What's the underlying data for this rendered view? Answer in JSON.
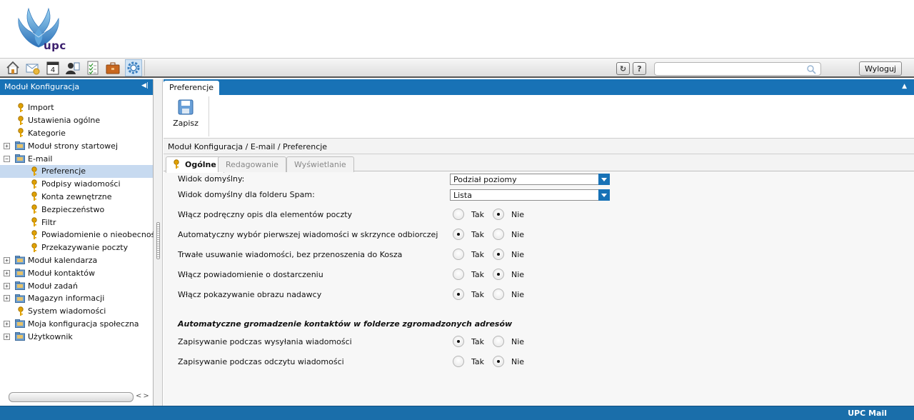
{
  "brand": {
    "logo_text": "upc"
  },
  "toolbar": {
    "icons": [
      "home-icon",
      "mail-icon",
      "calendar-icon",
      "contacts-icon",
      "tasks-icon",
      "briefcase-icon",
      "settings-icon"
    ],
    "calendar_day": "4",
    "refresh_label": "↻",
    "help_label": "?",
    "search_value": "",
    "logout_label": "Wyloguj"
  },
  "left_panel": {
    "title": "Moduł Konfiguracja",
    "items": [
      {
        "label": "Import",
        "type": "key",
        "level": 0,
        "expander": ""
      },
      {
        "label": "Ustawienia ogólne",
        "type": "key",
        "level": 0,
        "expander": ""
      },
      {
        "label": "Kategorie",
        "type": "key",
        "level": 0,
        "expander": ""
      },
      {
        "label": "Moduł strony startowej",
        "type": "folder",
        "level": 0,
        "expander": "+"
      },
      {
        "label": "E-mail",
        "type": "folder",
        "level": 0,
        "expander": "−"
      },
      {
        "label": "Preferencje",
        "type": "key",
        "level": 1,
        "expander": "",
        "selected": true
      },
      {
        "label": "Podpisy wiadomości",
        "type": "key",
        "level": 1,
        "expander": ""
      },
      {
        "label": "Konta zewnętrzne",
        "type": "key",
        "level": 1,
        "expander": ""
      },
      {
        "label": "Bezpieczeństwo",
        "type": "key",
        "level": 1,
        "expander": ""
      },
      {
        "label": "Filtr",
        "type": "key",
        "level": 1,
        "expander": ""
      },
      {
        "label": "Powiadomienie o nieobecności",
        "type": "key",
        "level": 1,
        "expander": ""
      },
      {
        "label": "Przekazywanie poczty",
        "type": "key",
        "level": 1,
        "expander": ""
      },
      {
        "label": "Moduł kalendarza",
        "type": "folder",
        "level": 0,
        "expander": "+"
      },
      {
        "label": "Moduł kontaktów",
        "type": "folder",
        "level": 0,
        "expander": "+"
      },
      {
        "label": "Moduł zadań",
        "type": "folder",
        "level": 0,
        "expander": "+"
      },
      {
        "label": "Magazyn informacji",
        "type": "folder",
        "level": 0,
        "expander": "+"
      },
      {
        "label": "System wiadomości",
        "type": "key",
        "level": 0,
        "expander": ""
      },
      {
        "label": "Moja konfiguracja społeczna",
        "type": "folder",
        "level": 0,
        "expander": "+"
      },
      {
        "label": "Użytkownik",
        "type": "folder",
        "level": 0,
        "expander": "+"
      }
    ]
  },
  "main": {
    "tab_label": "Preferencje",
    "save_label": "Zapisz",
    "breadcrumb": "Moduł Konfiguracja / E-mail / Preferencje",
    "subtabs": [
      "Ogólne",
      "Redagowanie",
      "Wyświetlanie"
    ],
    "form": {
      "selects": [
        {
          "label": "Widok domyślny:",
          "value": "Podział poziomy"
        },
        {
          "label": "Widok domyślny dla folderu Spam:",
          "value": "Lista"
        }
      ],
      "yes_label": "Tak",
      "no_label": "Nie",
      "radio_rows": [
        {
          "label": "Włącz podręczny opis dla elementów poczty",
          "value": "Nie"
        },
        {
          "label": "Automatyczny wybór pierwszej wiadomości w skrzynce odbiorczej",
          "value": "Tak"
        },
        {
          "label": "Trwałe usuwanie wiadomości, bez przenoszenia do Kosza",
          "value": "Nie"
        },
        {
          "label": "Włącz powiadomienie o dostarczeniu",
          "value": "Nie"
        },
        {
          "label": "Włącz pokazywanie obrazu nadawcy",
          "value": "Tak"
        }
      ],
      "section_title": "Automatyczne gromadzenie kontaktów w folderze zgromadzonych adresów",
      "section_rows": [
        {
          "label": "Zapisywanie podczas wysyłania wiadomości",
          "value": "Tak"
        },
        {
          "label": "Zapisywanie podczas odczytu wiadomości",
          "value": "Nie"
        }
      ]
    }
  },
  "footer": {
    "text": "UPC Mail"
  },
  "colors": {
    "accent": "#1872b6",
    "selected_row": "#c7daf0",
    "key_icon": "#e0a100"
  }
}
